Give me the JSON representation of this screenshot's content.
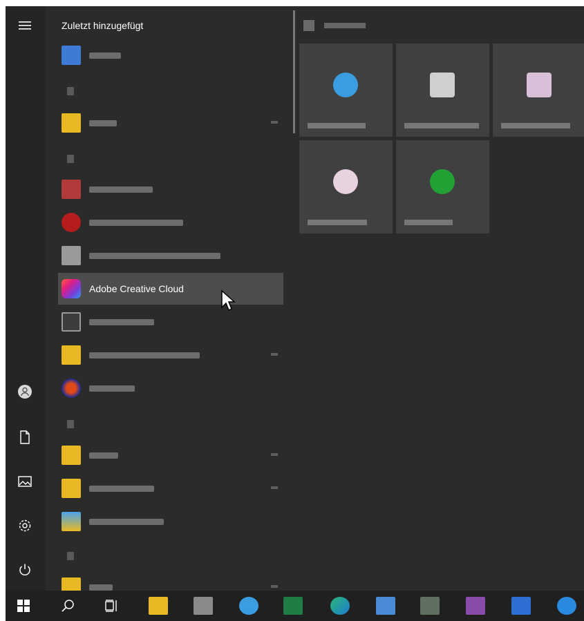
{
  "start_menu": {
    "recently_added_title": "Zuletzt hinzugefügt",
    "highlighted_app": "Adobe Creative Cloud"
  },
  "rail_icons": [
    "menu-icon",
    "user-icon",
    "documents-icon",
    "pictures-icon",
    "settings-icon",
    "power-icon"
  ],
  "taskbar_icons": [
    "windows-start-icon",
    "search-icon",
    "task-view-icon",
    "file-explorer-icon",
    "app-icon",
    "browser-icon",
    "excel-icon",
    "edge-icon",
    "mail-icon",
    "snipping-icon",
    "onenote-icon",
    "zoom-icon",
    "blue-app-icon"
  ],
  "colors": {
    "menu_bg": "#2b2b2b",
    "rail_bg": "#252525",
    "tile_bg": "#404040",
    "hover_bg": "#4d4d4d",
    "taskbar_bg": "#202020"
  }
}
